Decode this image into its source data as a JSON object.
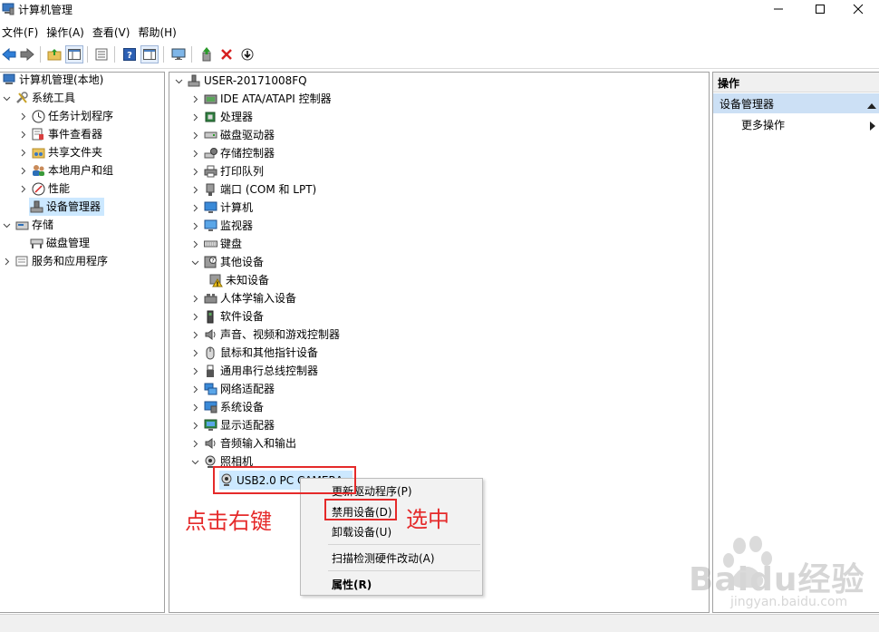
{
  "window": {
    "title": "计算机管理"
  },
  "menu": [
    "文件(F)",
    "操作(A)",
    "查看(V)",
    "帮助(H)"
  ],
  "toolbar": {
    "icons": [
      "back-icon",
      "forward-icon",
      "up-folder-icon",
      "show-tree-icon",
      "properties-icon",
      "help-icon",
      "view-icon",
      "monitor-icon",
      "update-driver-icon",
      "uninstall-icon",
      "download-icon"
    ]
  },
  "left_tree": {
    "root": "计算机管理(本地)",
    "system_tools": "系统工具",
    "task_scheduler": "任务计划程序",
    "event_viewer": "事件查看器",
    "shared_folders": "共享文件夹",
    "local_users": "本地用户和组",
    "performance": "性能",
    "device_manager": "设备管理器",
    "storage": "存储",
    "disk_management": "磁盘管理",
    "services": "服务和应用程序"
  },
  "device_tree": {
    "computer": "USER-20171008FQ",
    "categories": [
      {
        "label": "IDE ATA/ATAPI 控制器",
        "icon": "ide-controller-icon"
      },
      {
        "label": "处理器",
        "icon": "processor-icon"
      },
      {
        "label": "磁盘驱动器",
        "icon": "disk-drive-icon"
      },
      {
        "label": "存储控制器",
        "icon": "storage-controller-icon"
      },
      {
        "label": "打印队列",
        "icon": "printer-icon"
      },
      {
        "label": "端口 (COM 和 LPT)",
        "icon": "port-icon"
      },
      {
        "label": "计算机",
        "icon": "computer-icon"
      },
      {
        "label": "监视器",
        "icon": "monitor-icon"
      },
      {
        "label": "键盘",
        "icon": "keyboard-icon"
      },
      {
        "label": "其他设备",
        "icon": "other-devices-icon"
      }
    ],
    "unknown_device": "未知设备",
    "categories2": [
      {
        "label": "人体学输入设备",
        "icon": "hid-icon"
      },
      {
        "label": "软件设备",
        "icon": "software-device-icon"
      },
      {
        "label": "声音、视频和游戏控制器",
        "icon": "speaker-icon"
      },
      {
        "label": "鼠标和其他指针设备",
        "icon": "mouse-icon"
      },
      {
        "label": "通用串行总线控制器",
        "icon": "usb-icon"
      },
      {
        "label": "网络适配器",
        "icon": "network-adapter-icon"
      },
      {
        "label": "系统设备",
        "icon": "system-device-icon"
      },
      {
        "label": "显示适配器",
        "icon": "display-adapter-icon"
      },
      {
        "label": "音频输入和输出",
        "icon": "audio-io-icon"
      },
      {
        "label": "照相机",
        "icon": "camera-icon"
      }
    ],
    "camera_device": "USB2.0 PC CAMERA"
  },
  "actions": {
    "header": "操作",
    "section": "设备管理器",
    "more": "更多操作"
  },
  "context_menu": {
    "update_driver": "更新驱动程序(P)",
    "disable_device": "禁用设备(D)",
    "uninstall_device": "卸载设备(U)",
    "scan_hardware": "扫描检测硬件改动(A)",
    "properties": "属性(R)"
  },
  "annotations": {
    "right_click": "点击右键",
    "select": "选中"
  },
  "watermark": {
    "brand": "Baidu经验",
    "url": "jingyan.baidu.com"
  },
  "colors": {
    "selection": "#cce8ff",
    "annotation_red": "#e52a2a",
    "action_section": "#cce0f5"
  }
}
